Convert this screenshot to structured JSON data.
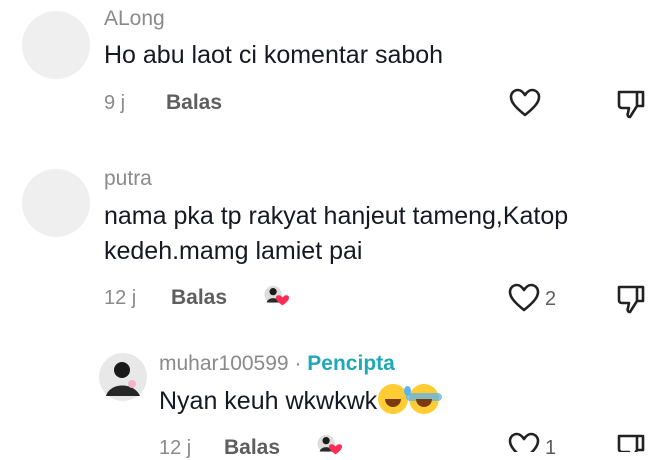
{
  "comments": [
    {
      "username": "ALong",
      "text": "Ho abu laot ci komentar saboh",
      "time": "9 j",
      "reply_label": "Balas",
      "likes": ""
    },
    {
      "username": "putra",
      "text_line1": "nama pka tp rakyat hanjeut tameng,Katop",
      "text_line2": "kedeh.mamg lamiet pai",
      "time": "12 j",
      "reply_label": "Balas",
      "likes": "2",
      "reply": {
        "username": "muhar100599",
        "separator": "·",
        "creator_badge": "Pencipta",
        "text": "Nyan keuh wkwkwk",
        "emojis": [
          "grinning-sweat-emoji",
          "tears-of-joy-emoji"
        ],
        "time": "12 j",
        "reply_label": "Balas",
        "likes": "1"
      }
    }
  ],
  "icons": {
    "like": "heart-outline-icon",
    "dislike": "thumbs-down-icon",
    "creator_liked": "creator-liked-badge"
  },
  "colors": {
    "creator_badge": "#20a8b8",
    "heart_badge": "#fe2c55"
  }
}
